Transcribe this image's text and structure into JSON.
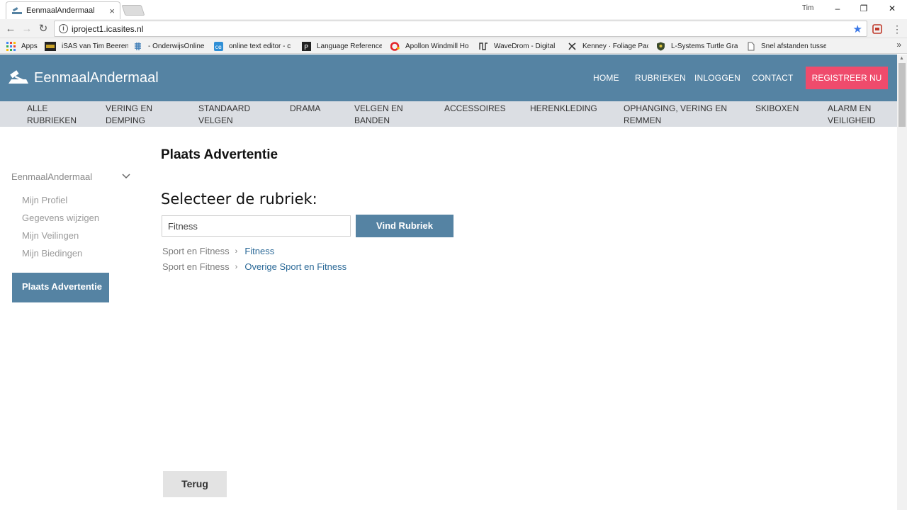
{
  "browser": {
    "tab_title": "EenmaalAndermaal",
    "tab_close": "×",
    "user": "Tim",
    "url": "iproject1.icasites.nl",
    "bookmarks": [
      {
        "label": "Apps",
        "icon": "apps-grid-icon"
      },
      {
        "label": "iSAS van Tim Beeren",
        "icon": "isas-icon"
      },
      {
        "label": "- OnderwijsOnline",
        "icon": "onderwijsonline-icon"
      },
      {
        "label": "online text editor - c",
        "icon": "ce-icon"
      },
      {
        "label": "Language Reference",
        "icon": "p-icon"
      },
      {
        "label": "Apollon Windmill Ho",
        "icon": "c-logo-icon"
      },
      {
        "label": "WaveDrom - Digital",
        "icon": "wavedrom-icon"
      },
      {
        "label": "Kenney · Foliage Pac",
        "icon": "kenney-icon"
      },
      {
        "label": "L-Systems Turtle Gra",
        "icon": "shield-icon"
      },
      {
        "label": "Snel afstanden tusse",
        "icon": "page-icon"
      }
    ],
    "more": "»"
  },
  "header": {
    "logo": "EenmaalAndermaal",
    "nav": [
      "HOME",
      "RUBRIEKEN",
      "INLOGGEN",
      "CONTACT"
    ],
    "register": "REGISTREER NU"
  },
  "categories": [
    [
      "ALLE",
      "RUBRIEKEN"
    ],
    [
      "VERING EN",
      "DEMPING"
    ],
    [
      "STANDAARD",
      "VELGEN"
    ],
    [
      "DRAMA",
      ""
    ],
    [
      "VELGEN EN",
      "BANDEN"
    ],
    [
      "ACCESSOIRES",
      ""
    ],
    [
      "HERENKLEDING",
      ""
    ],
    [
      "OPHANGING, VERING EN",
      "REMMEN"
    ],
    [
      "SKIBOXEN",
      ""
    ],
    [
      "ALARM EN",
      "VEILIGHEID"
    ]
  ],
  "sidebar": {
    "title": "EenmaalAndermaal",
    "items": [
      "Mijn Profiel",
      "Gegevens wijzigen",
      "Mijn Veilingen",
      "Mijn Biedingen"
    ],
    "active": "Plaats Advertentie"
  },
  "main": {
    "title": "Plaats Advertentie",
    "select_label": "Selecteer de rubriek:",
    "search_value": "Fitness",
    "find_button": "Vind Rubriek",
    "results": [
      {
        "parent": "Sport en Fitness",
        "separator": "›",
        "link": "Fitness"
      },
      {
        "parent": "Sport en Fitness",
        "separator": "›",
        "link": "Overige Sport en Fitness"
      }
    ],
    "back_button": "Terug"
  },
  "colors": {
    "header": "#5583a3",
    "register": "#ef4b6c",
    "catbar": "#dbdee3",
    "link": "#2c6a98"
  }
}
